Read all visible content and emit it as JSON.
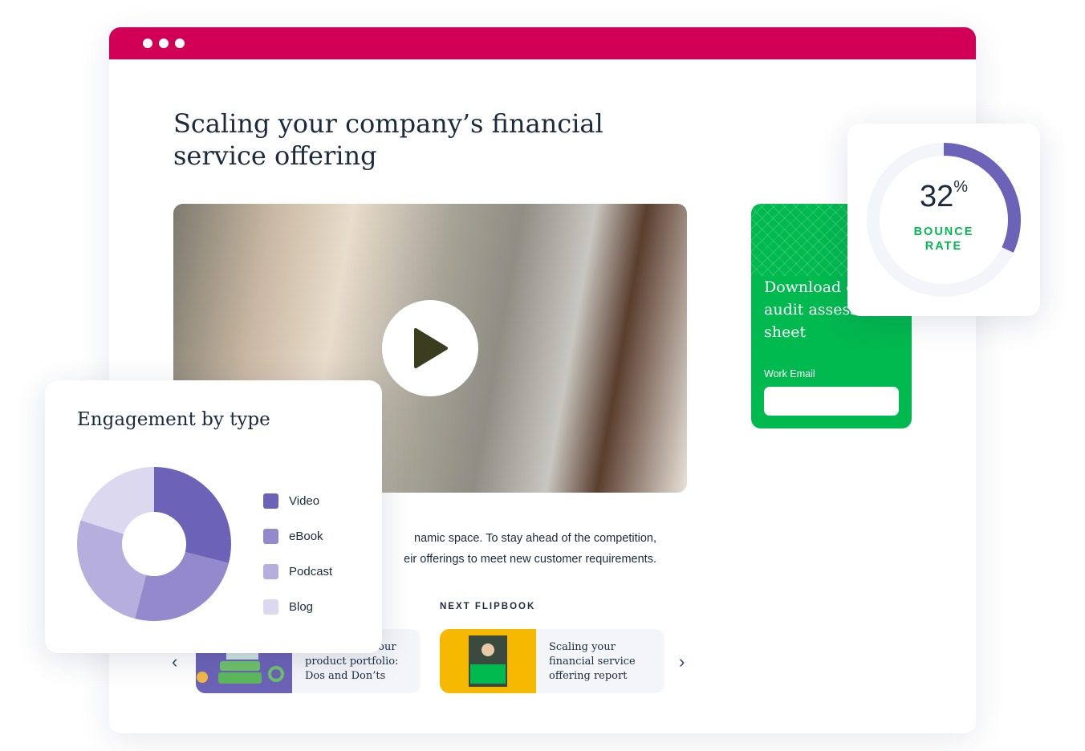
{
  "window": {
    "accent": "#d10056",
    "title": "Scaling your company’s financial service offering"
  },
  "video": {
    "play_icon": "play-icon"
  },
  "body_text": [
    "namic space. To stay ahead of the competition,",
    "eir offerings to meet new customer requirements."
  ],
  "next_flipbook": {
    "label": "NEXT FLIPBOOK",
    "cards": [
      {
        "title": "Diversifying your product portfolio: Dos and Don’ts"
      },
      {
        "title": "Scaling your financial service offering report"
      }
    ]
  },
  "form": {
    "heading": "Download our free audit assessment sheet",
    "email_label": "Work Email",
    "email_value": "",
    "color": "#00b94f"
  },
  "bounce": {
    "value": "32",
    "unit": "%",
    "label": "BOUNCE RATE",
    "fraction": 0.32,
    "color": "#6c63b8"
  },
  "chart_data": {
    "type": "pie",
    "title": "Engagement by type",
    "categories": [
      "Video",
      "eBook",
      "Podcast",
      "Blog"
    ],
    "values": [
      29,
      25,
      26,
      20
    ],
    "colors": [
      "#6c63b8",
      "#9389cc",
      "#b6aedd",
      "#dcd8ef"
    ],
    "donut": true,
    "legend": "right"
  }
}
